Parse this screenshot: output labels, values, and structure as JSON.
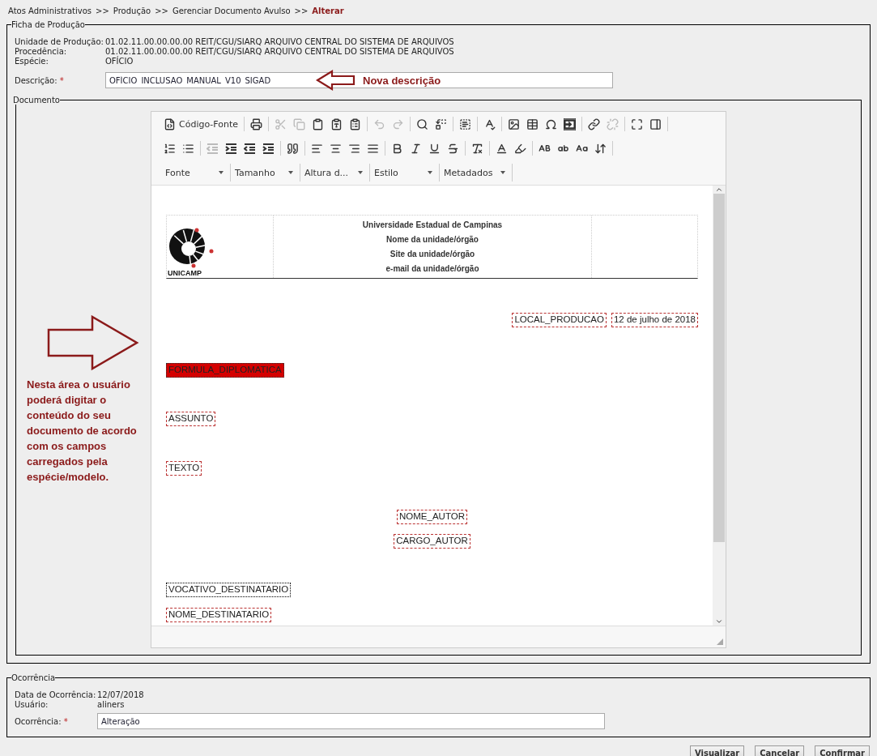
{
  "breadcrumb": {
    "separator": ">>",
    "items": [
      {
        "label": "Atos Administrativos",
        "current": false
      },
      {
        "label": "Produção",
        "current": false
      },
      {
        "label": "Gerenciar Documento Avulso",
        "current": false
      },
      {
        "label": "Alterar",
        "current": true
      }
    ]
  },
  "ficha": {
    "legend": "Ficha de Produção",
    "fields": [
      {
        "label": "Unidade de Produção:",
        "value": "01.02.11.00.00.00.00 REIT/CGU/SIARQ ARQUIVO CENTRAL DO SISTEMA DE ARQUIVOS"
      },
      {
        "label": "Procedência:",
        "value": "01.02.11.00.00.00.00 REIT/CGU/SIARQ ARQUIVO CENTRAL DO SISTEMA DE ARQUIVOS"
      },
      {
        "label": "Espécie:",
        "value": "OFÍCIO"
      }
    ],
    "description": {
      "label": "Descrição:",
      "required": true,
      "required_mark": "*",
      "value": "OFÍCIO_INCLUSAO_MANUAL_V10_SIGAD",
      "annotation": "Nova descrição"
    }
  },
  "documento": {
    "legend": "Documento",
    "annotation": "Nesta área o usuário poderá digitar o conteúdo do seu documento de acordo com os campos carregados pela espécie/modelo.",
    "toolbar": {
      "row_1": [
        [
          {
            "disabled": false,
            "label": "Código-Fonte"
          }
        ],
        [
          {
            "disabled": false
          }
        ],
        [
          {
            "disabled": true
          },
          {
            "disabled": true
          },
          {
            "disabled": false
          },
          {
            "disabled": false
          },
          {
            "disabled": false
          }
        ],
        [
          {
            "disabled": true
          },
          {
            "disabled": true
          }
        ],
        [
          {
            "disabled": false
          },
          {
            "disabled": false
          }
        ],
        [
          {
            "disabled": false
          }
        ],
        [
          {
            "disabled": false
          }
        ],
        [
          {
            "disabled": false
          },
          {
            "disabled": false
          },
          {
            "disabled": false
          },
          {
            "disabled": false
          }
        ],
        [
          {
            "disabled": false
          },
          {
            "disabled": true
          }
        ],
        [
          {
            "disabled": false
          },
          {
            "disabled": false
          }
        ]
      ],
      "row_2": [
        [
          {
            "disabled": false
          },
          {
            "disabled": false
          }
        ],
        [
          {
            "disabled": true
          },
          {
            "disabled": false
          },
          {
            "disabled": false
          },
          {
            "disabled": false
          }
        ],
        [
          {
            "disabled": false
          }
        ],
        [
          {
            "disabled": false
          },
          {
            "disabled": false
          },
          {
            "disabled": false
          },
          {
            "disabled": false
          }
        ],
        [
          {
            "disabled": false
          },
          {
            "disabled": false
          },
          {
            "disabled": false
          },
          {
            "disabled": false
          }
        ],
        [
          {
            "disabled": false
          }
        ],
        [
          {
            "disabled": false
          },
          {
            "disabled": false
          }
        ],
        [
          {
            "disabled": false
          },
          {
            "disabled": false
          },
          {
            "disabled": false
          },
          {
            "disabled": false
          }
        ]
      ],
      "dropdowns": [
        "Fonte",
        "Tamanho",
        "Altura d...",
        "Estilo",
        "Metadados"
      ]
    },
    "letterhead": {
      "logo_text": "UNICAMP",
      "lines": [
        "Universidade Estadual de Campinas",
        "Nome da unidade/órgão",
        "Site da unidade/órgão",
        "e-mail da unidade/órgão"
      ]
    },
    "paragraphs": [
      {
        "kind": "right",
        "fields": [
          {
            "text": "LOCAL_PRODUCAO",
            "kind": "dashed"
          },
          {
            "text": "12 de julho de 2018",
            "kind": "dashed"
          }
        ]
      },
      {
        "kind": "left",
        "fields": [
          {
            "text": "FORMULA_DIPLOMATICA",
            "kind": "highlight"
          }
        ]
      },
      {
        "kind": "left",
        "fields": [
          {
            "text": "ASSUNTO",
            "kind": "dashed"
          }
        ]
      },
      {
        "kind": "left",
        "fields": [
          {
            "text": "TEXTO",
            "kind": "dashed"
          }
        ]
      },
      {
        "kind": "center",
        "fields": [
          {
            "text": "NOME_AUTOR",
            "kind": "dashed"
          }
        ]
      },
      {
        "kind": "center",
        "fields": [
          {
            "text": "CARGO_AUTOR",
            "kind": "dashed"
          }
        ]
      },
      {
        "kind": "left",
        "fields": [
          {
            "text": "VOCATIVO_DESTINATARIO",
            "kind": "dotted"
          }
        ]
      },
      {
        "kind": "left",
        "fields": [
          {
            "text": "NOME_DESTINATARIO",
            "kind": "dashed"
          }
        ]
      }
    ]
  },
  "ocorrencia": {
    "legend": "Ocorrência",
    "fields": [
      {
        "label": "Data de Ocorrência:",
        "value": "12/07/2018"
      },
      {
        "label": "Usuário:",
        "value": "aliners"
      }
    ],
    "input": {
      "label": "Ocorrência:",
      "required": true,
      "required_mark": "*",
      "value": "Alteração"
    }
  },
  "buttons": [
    "Visualizar",
    "Cancelar",
    "Confirmar"
  ]
}
